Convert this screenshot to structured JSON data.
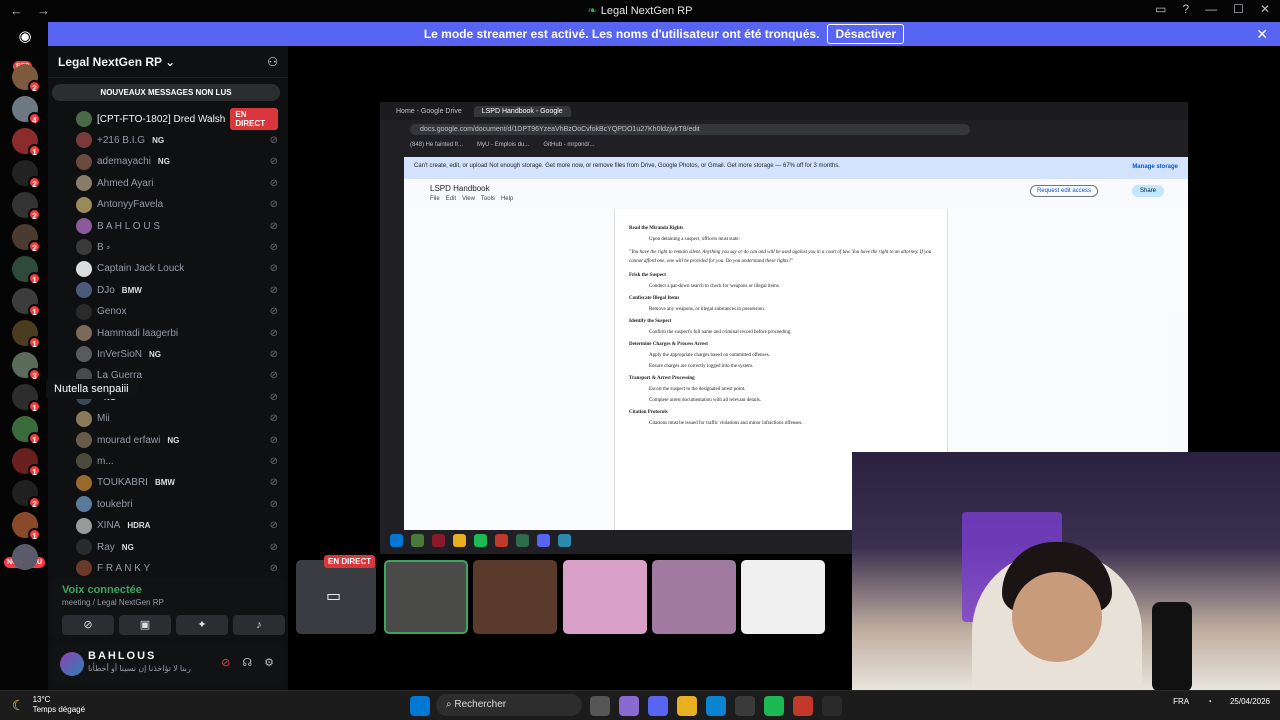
{
  "window": {
    "title": "Legal NextGen RP",
    "back_icon": "←",
    "fwd_icon": "→"
  },
  "banner": {
    "message": "Le mode streamer est activé. Les noms d'utilisateur ont été tronqués.",
    "button": "Désactiver",
    "close": "✕"
  },
  "rail": {
    "home_badge": "852",
    "new_label": "NOUVEAU",
    "servers": [
      {
        "badge": "2",
        "color": "#7d5a3c"
      },
      {
        "badge": "4",
        "color": "#6d7a84"
      },
      {
        "badge": "1",
        "color": "#8b2b2b"
      },
      {
        "badge": "2",
        "color": "#222222"
      },
      {
        "badge": "2",
        "color": "#333333"
      },
      {
        "badge": "2",
        "color": "#4a3b2e"
      },
      {
        "badge": "1",
        "color": "#2f4a3a"
      },
      {
        "badge": "1",
        "color": "#3c3c3c"
      },
      {
        "badge": "1",
        "color": "#4b3b1f"
      },
      {
        "badge": "3",
        "color": "#5a6b5a"
      },
      {
        "badge": "1",
        "color": "#2d2d2d"
      },
      {
        "badge": "1",
        "color": "#3b6b3b"
      },
      {
        "badge": "1",
        "color": "#6b2020"
      },
      {
        "badge": "2",
        "color": "#202020"
      },
      {
        "badge": "1",
        "color": "#8a4a2a"
      },
      {
        "badge": "",
        "color": "#5a5a6a"
      }
    ]
  },
  "sidebar": {
    "server_name": "Legal NextGen RP",
    "new_messages": "NOUVEAUX MESSAGES NON LUS",
    "tooltip": "Nutella senpaiii",
    "members": [
      {
        "name": "[CPT-FTO-1802] Dred Walsh",
        "tag": "",
        "live": "EN DIRECT",
        "color": "#4a6a4a"
      },
      {
        "name": "+216 B.I.G",
        "tag": "NG",
        "live": "",
        "color": "#7a3a3a"
      },
      {
        "name": "ademayachi",
        "tag": "NG",
        "live": "",
        "color": "#6a4a3a"
      },
      {
        "name": "Ahmed Ayari",
        "tag": "",
        "live": "",
        "color": "#8a7a6a"
      },
      {
        "name": "AntonyyFavela",
        "tag": "",
        "live": "",
        "color": "#9a8a5a"
      },
      {
        "name": "B A H L O U S",
        "tag": "",
        "live": "",
        "color": "#8a5a9a"
      },
      {
        "name": "B ⸗",
        "tag": "",
        "live": "",
        "color": "#3a3a3a"
      },
      {
        "name": "Captain Jack Louck",
        "tag": "",
        "live": "",
        "color": "#dddddd"
      },
      {
        "name": "DJo",
        "tag": "BMW",
        "live": "",
        "color": "#4a5a7a"
      },
      {
        "name": "Genox",
        "tag": "",
        "live": "",
        "color": "#2a2a2a"
      },
      {
        "name": "Hammadi laagerbi",
        "tag": "",
        "live": "",
        "color": "#7a6a5a"
      },
      {
        "name": "InVerSioN",
        "tag": "NG",
        "live": "",
        "color": "#5a5a5a"
      },
      {
        "name": "La Guerra",
        "tag": "",
        "live": "",
        "color": "#4a4a4a"
      },
      {
        "name": "",
        "tag": "NG",
        "live": "",
        "color": "#3a4a5a"
      },
      {
        "name": "Mii",
        "tag": "",
        "live": "",
        "color": "#8a7a5a"
      },
      {
        "name": "mourad erfawi",
        "tag": "NG",
        "live": "",
        "color": "#6a5a4a"
      },
      {
        "name": "m...",
        "tag": "",
        "live": "",
        "color": "#4a4a3a"
      },
      {
        "name": "TOUKABRI",
        "tag": "BMW",
        "live": "",
        "color": "#9a6a2a"
      },
      {
        "name": "toukebri",
        "tag": "",
        "live": "",
        "color": "#5a7a9a"
      },
      {
        "name": "XINA",
        "tag": "HDRA",
        "live": "",
        "color": "#9a9a9a"
      },
      {
        "name": "Ray",
        "tag": "NG",
        "live": "",
        "color": "#2a2a2a"
      },
      {
        "name": "F R A N K Y",
        "tag": "",
        "live": "",
        "color": "#6a3a2a"
      }
    ]
  },
  "voice": {
    "status": "Voix connectée",
    "channel": "meeting / Legal NextGen RP"
  },
  "user": {
    "name": "BAHLOUS",
    "status": "ربنا لا تؤاخذنا إن نسينا أو أخطأنا"
  },
  "browser": {
    "tab1": "Home - Google Drive",
    "tab2": "LSPD Handbook - Google",
    "url": "docs.google.com/document/d/1DPT96YzeaVhBzOoCvfokBcYQPDO1u27Kh0ldzjvlrT8/edit",
    "bookmarks": [
      "(848) He fainted fr...",
      "MyU - Emplois du...",
      "GitHub - mrpond/..."
    ],
    "warning": "Can't create, edit, or upload Not enough storage. Get more now, or remove files from Drive, Google Photos, or Gmail. Get more storage — 67% off for 3 months.",
    "manage": "Manage storage",
    "doc_name": "LSPD Handbook",
    "menu": [
      "File",
      "Edit",
      "View",
      "Tools",
      "Help"
    ],
    "request": "Request edit access",
    "share": "Share"
  },
  "doc": {
    "h1": "Read the Miranda Rights",
    "l1": "Upon detaining a suspect, officers must state:",
    "quote": "\"You have the right to remain silent. Anything you say or do can and will be used against you in a court of law. You have the right to an attorney. If you cannot afford one, one will be provided for you. Do you understand these rights?\"",
    "h2": "Frisk the Suspect",
    "l2": "Conduct a pat-down search to check for weapons or illegal items.",
    "h3": "Confiscate Illegal Items",
    "l3": "Remove any weapons, or illegal substances in possession.",
    "h4": "Identify the Suspect",
    "l4": "Confirm the suspect's full name and criminal record before proceeding.",
    "h5": "Determine Charges & Process Arrest",
    "l5a": "Apply the appropriate charges based on committed offenses.",
    "l5b": "Ensure charges are correctly logged into the system.",
    "h6": "Transport & Arrest Processing",
    "l6a": "Escort the suspect to the designated arrest point.",
    "l6b": "Complete arrest documentation with all relevant details.",
    "h7": "Citation Protocols",
    "l7": "Citations must be issued for traffic violations and minor infractions offenses."
  },
  "tiles": {
    "live_label": "EN DIRECT"
  },
  "taskbar": {
    "temp": "13°C",
    "weather": "Temps dégagé",
    "search": "Rechercher",
    "lang": "FRA",
    "date": "25/04/2026"
  }
}
